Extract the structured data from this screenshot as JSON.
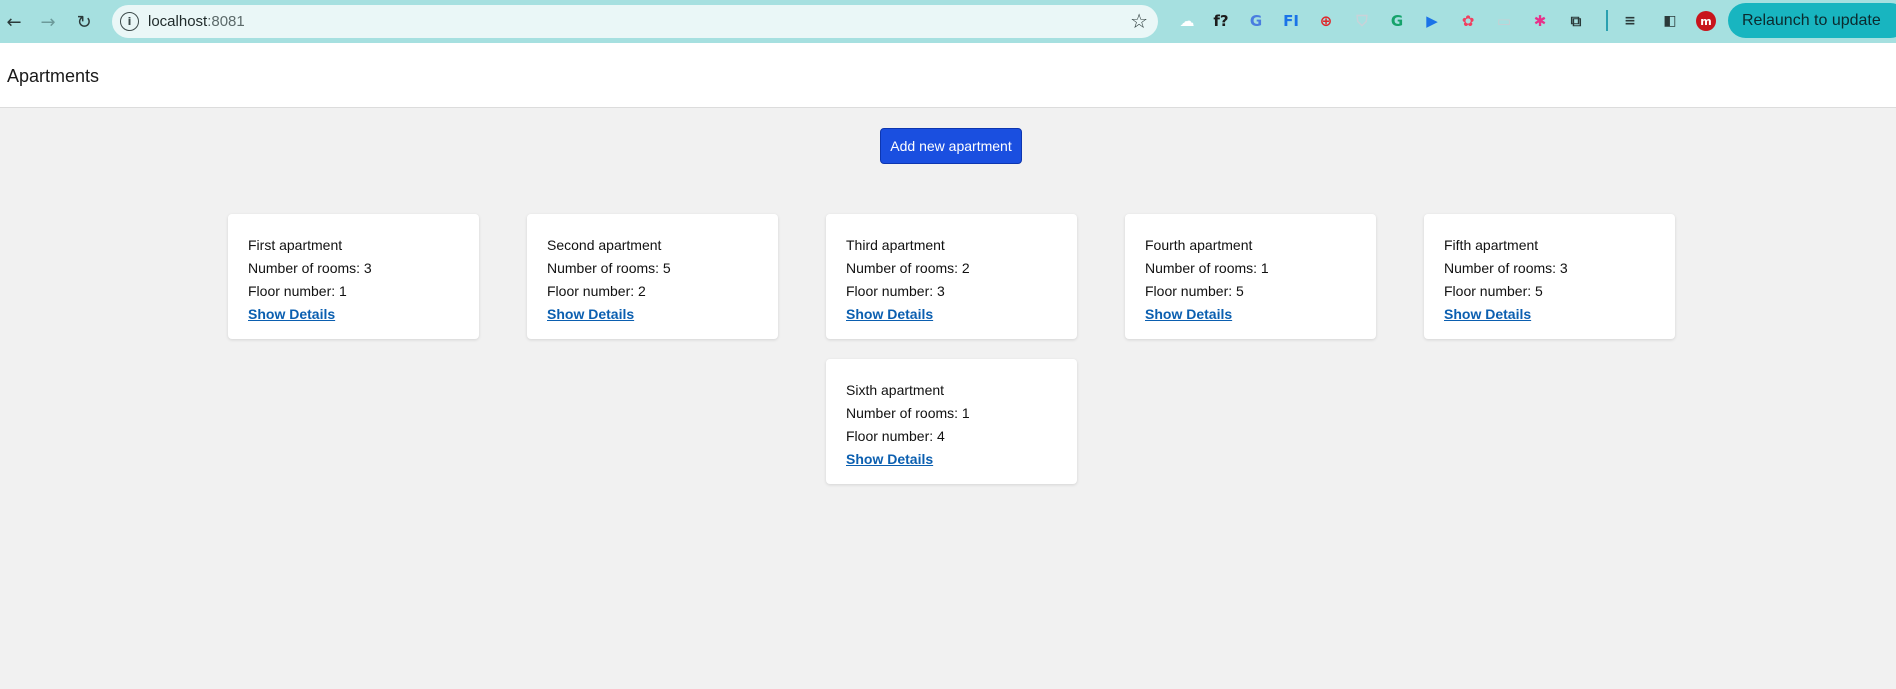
{
  "browser": {
    "url_host": "localhost",
    "url_port": ":8081",
    "relaunch_label": "Relaunch to update",
    "extensions": [
      {
        "name": "cloud-extension-icon",
        "glyph": "☁",
        "color": "#ffffff"
      },
      {
        "name": "formula-extension-icon",
        "glyph": "f?",
        "color": "#1c1c1c"
      },
      {
        "name": "translate-extension-icon",
        "glyph": "G",
        "color": "#4a7de0"
      },
      {
        "name": "fi-extension-icon",
        "glyph": "FI",
        "color": "#1a73e8"
      },
      {
        "name": "red-extension-icon",
        "glyph": "⊕",
        "color": "#e0262a"
      },
      {
        "name": "shield-extension-icon",
        "glyph": "⛉",
        "color": "#c9d2d8"
      },
      {
        "name": "grammarly-extension-icon",
        "glyph": "G",
        "color": "#15a36b"
      },
      {
        "name": "play-extension-icon",
        "glyph": "▶",
        "color": "#1a73e8"
      },
      {
        "name": "pink-extension-icon",
        "glyph": "✿",
        "color": "#f04060"
      },
      {
        "name": "gray-extension-icon",
        "glyph": "▭",
        "color": "#c8cfd2"
      },
      {
        "name": "magenta-extension-icon",
        "glyph": "✱",
        "color": "#e8308a"
      },
      {
        "name": "puzzle-extension-icon",
        "glyph": "⧉",
        "color": "#2b3a3a"
      }
    ]
  },
  "header": {
    "title": "Apartments"
  },
  "actions": {
    "add_label": "Add new apartment"
  },
  "apartments": [
    {
      "name": "First apartment",
      "rooms": "Number of rooms: 3",
      "floor": "Floor number: 1",
      "link": "Show Details"
    },
    {
      "name": "Second apartment",
      "rooms": "Number of rooms: 5",
      "floor": "Floor number: 2",
      "link": "Show Details"
    },
    {
      "name": "Third apartment",
      "rooms": "Number of rooms: 2",
      "floor": "Floor number: 3",
      "link": "Show Details"
    },
    {
      "name": "Fourth apartment",
      "rooms": "Number of rooms: 1",
      "floor": "Floor number: 5",
      "link": "Show Details"
    },
    {
      "name": "Fifth apartment",
      "rooms": "Number of rooms: 3",
      "floor": "Floor number: 5",
      "link": "Show Details"
    },
    {
      "name": "Sixth apartment",
      "rooms": "Number of rooms: 1",
      "floor": "Floor number: 4",
      "link": "Show Details"
    }
  ]
}
